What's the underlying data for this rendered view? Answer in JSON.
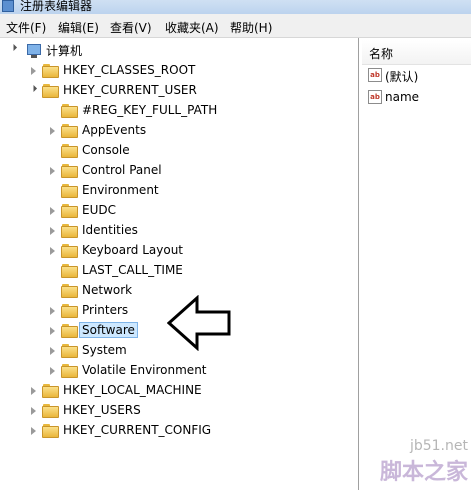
{
  "window": {
    "title": "注册表编辑器"
  },
  "menu": [
    {
      "label": "文件(F)"
    },
    {
      "label": "编辑(E)"
    },
    {
      "label": "查看(V)"
    },
    {
      "label": "收藏夹(A)"
    },
    {
      "label": "帮助(H)"
    }
  ],
  "tree": {
    "root": "计算机",
    "hives": [
      {
        "label": "HKEY_CLASSES_ROOT",
        "state": "collapsed"
      },
      {
        "label": "HKEY_CURRENT_USER",
        "state": "expanded"
      },
      {
        "label": "HKEY_LOCAL_MACHINE",
        "state": "collapsed"
      },
      {
        "label": "HKEY_USERS",
        "state": "collapsed"
      },
      {
        "label": "HKEY_CURRENT_CONFIG",
        "state": "collapsed"
      }
    ],
    "children": [
      {
        "label": "#REG_KEY_FULL_PATH",
        "state": "leaf"
      },
      {
        "label": "AppEvents",
        "state": "collapsed"
      },
      {
        "label": "Console",
        "state": "leaf"
      },
      {
        "label": "Control Panel",
        "state": "collapsed"
      },
      {
        "label": "Environment",
        "state": "leaf"
      },
      {
        "label": "EUDC",
        "state": "collapsed"
      },
      {
        "label": "Identities",
        "state": "collapsed"
      },
      {
        "label": "Keyboard Layout",
        "state": "collapsed"
      },
      {
        "label": "LAST_CALL_TIME",
        "state": "leaf"
      },
      {
        "label": "Network",
        "state": "leaf"
      },
      {
        "label": "Printers",
        "state": "collapsed"
      },
      {
        "label": "Software",
        "state": "collapsed",
        "selected": true
      },
      {
        "label": "System",
        "state": "collapsed"
      },
      {
        "label": "Volatile Environment",
        "state": "collapsed"
      }
    ]
  },
  "list": {
    "column_name": "名称",
    "values": [
      {
        "icon": "string-value-icon",
        "icon_text": "ab",
        "name": "(默认)"
      },
      {
        "icon": "string-value-icon",
        "icon_text": "ab",
        "name": "name"
      }
    ]
  },
  "watermark": {
    "site": "jb51.net",
    "brand": "脚本之家"
  }
}
